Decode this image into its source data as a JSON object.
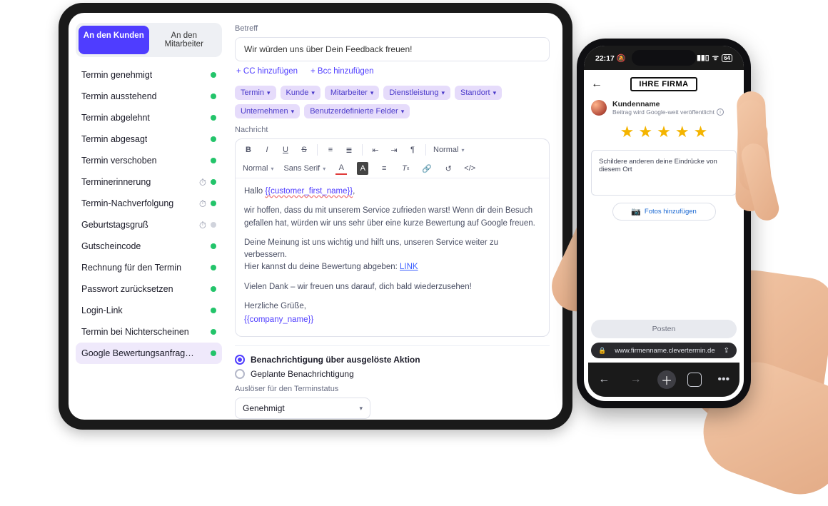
{
  "tabs": {
    "customer": "An den Kunden",
    "staff": "An den\nMitarbeiter"
  },
  "templates": [
    {
      "label": "Termin genehmigt",
      "timer": false,
      "status": "green"
    },
    {
      "label": "Termin ausstehend",
      "timer": false,
      "status": "green"
    },
    {
      "label": "Termin abgelehnt",
      "timer": false,
      "status": "green"
    },
    {
      "label": "Termin abgesagt",
      "timer": false,
      "status": "green"
    },
    {
      "label": "Termin verschoben",
      "timer": false,
      "status": "green"
    },
    {
      "label": "Terminerinnerung",
      "timer": true,
      "status": "green"
    },
    {
      "label": "Termin-Nachverfolgung",
      "timer": true,
      "status": "green"
    },
    {
      "label": "Geburtstagsgruß",
      "timer": true,
      "status": "grey"
    },
    {
      "label": "Gutscheincode",
      "timer": false,
      "status": "green"
    },
    {
      "label": "Rechnung für den Termin",
      "timer": false,
      "status": "green"
    },
    {
      "label": "Passwort zurücksetzen",
      "timer": false,
      "status": "green"
    },
    {
      "label": "Login-Link",
      "timer": false,
      "status": "green"
    },
    {
      "label": "Termin bei Nichterscheinen",
      "timer": false,
      "status": "green"
    },
    {
      "label": "Google Bewertungsanfrage s…",
      "timer": false,
      "status": "green",
      "selected": true
    }
  ],
  "subject": {
    "label": "Betreff",
    "value": "Wir würden uns über Dein Feedback freuen!"
  },
  "cc": {
    "add_cc": "+  CC hinzufügen",
    "add_bcc": "+  Bcc hinzufügen"
  },
  "chips": [
    "Termin",
    "Kunde",
    "Mitarbeiter",
    "Dienstleistung",
    "Standort",
    "Unternehmen",
    "Benutzerdefinierte Felder"
  ],
  "message_label": "Nachricht",
  "toolbar": {
    "bold": "B",
    "italic": "I",
    "underline": "U",
    "strike": "S",
    "heading": "Normal",
    "font": "Sans Serif",
    "size": "Normal",
    "color_letter": "A"
  },
  "body": {
    "greeting_pre": "Hallo ",
    "greeting_ph": "{{customer_first_name}}",
    "greeting_post": ",",
    "p1": "wir hoffen, dass du mit unserem Service zufrieden warst! Wenn dir dein Besuch gefallen hat, würden wir uns sehr über eine kurze Bewertung auf Google freuen.",
    "p2": "Deine Meinung ist uns wichtig und hilft uns, unseren Service weiter zu verbessern.",
    "p3_pre": "Hier kannst du deine Bewertung abgeben: ",
    "p3_link": "LINK",
    "p4": "Vielen Dank – wir freuen uns darauf, dich bald wiederzusehen!",
    "sig1": "Herzliche Grüße,",
    "sig2": "{{company_name}}"
  },
  "trigger": {
    "opt1": "Benachrichtigung über ausgelöste Aktion",
    "opt2": "Geplante Benachrichtigung",
    "status_label": "Auslöser für den Terminstatus",
    "status_value": "Genehmigt"
  },
  "phone": {
    "time": "22:17",
    "battery": "64",
    "brand": "IHRE FIRMA",
    "username": "Kundenname",
    "user_meta": "Beitrag wird Google-weit veröffentlicht",
    "textarea_ph": "Schildere anderen deine Eindrücke von diesem Ort",
    "add_photos": "Fotos hinzufügen",
    "post": "Posten",
    "url": "www.firmenname.clevertermin.de"
  }
}
